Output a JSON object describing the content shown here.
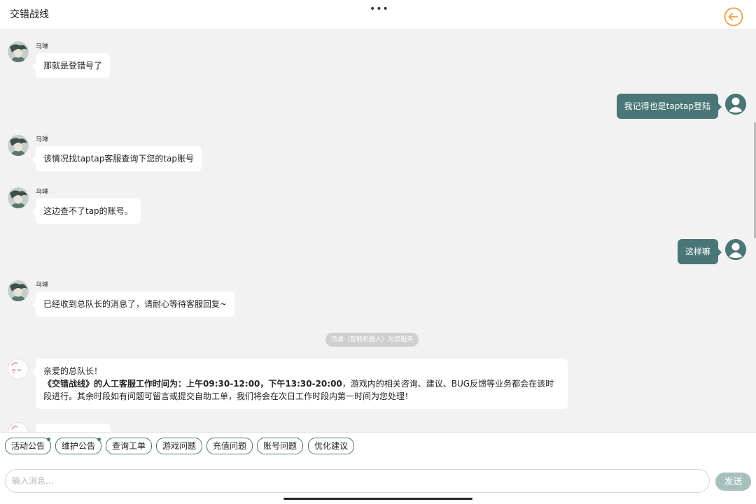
{
  "header": {
    "title": "交错战线",
    "more_label": "•••"
  },
  "agent_name": "乌琳",
  "messages": [
    {
      "text": "那就是登错号了"
    },
    {
      "text": "我记得也是taptap登陆"
    },
    {
      "text": "该情况找taptap客服查询下您的tap账号"
    },
    {
      "text": "这边查不了tap的账号。"
    },
    {
      "text": "这样嘛"
    },
    {
      "text": "已经收到总队长的消息了，请耐心等待客服回复~"
    }
  ],
  "system_notice": "乌波（智能机器人）为您服务",
  "bot_message": {
    "greeting": "亲爱的总队长！",
    "prefix": "《交错战线》的人工客服工作时间为：",
    "hours": "上午09:30-12:00，下午13:30-20:00",
    "rest": "，游戏内的相关咨询、建议、BUG反馈等业务都会在该时段进行。其余时段如有问题可留言或提交自助工单，我们将会在次日工作时段内第一时间为您处理！"
  },
  "quick_tags": [
    {
      "label": "活动公告",
      "dot": true
    },
    {
      "label": "维护公告",
      "dot": true
    },
    {
      "label": "查询工单",
      "dot": false
    },
    {
      "label": "游戏问题",
      "dot": false
    },
    {
      "label": "充值问题",
      "dot": false
    },
    {
      "label": "账号问题",
      "dot": false
    },
    {
      "label": "优化建议",
      "dot": false
    }
  ],
  "input": {
    "placeholder": "输入消息...",
    "value": ""
  },
  "send_label": "发送",
  "colors": {
    "accent": "#4a7677",
    "send_disabled": "#a7c0be",
    "back_icon": "#e8a33c"
  }
}
